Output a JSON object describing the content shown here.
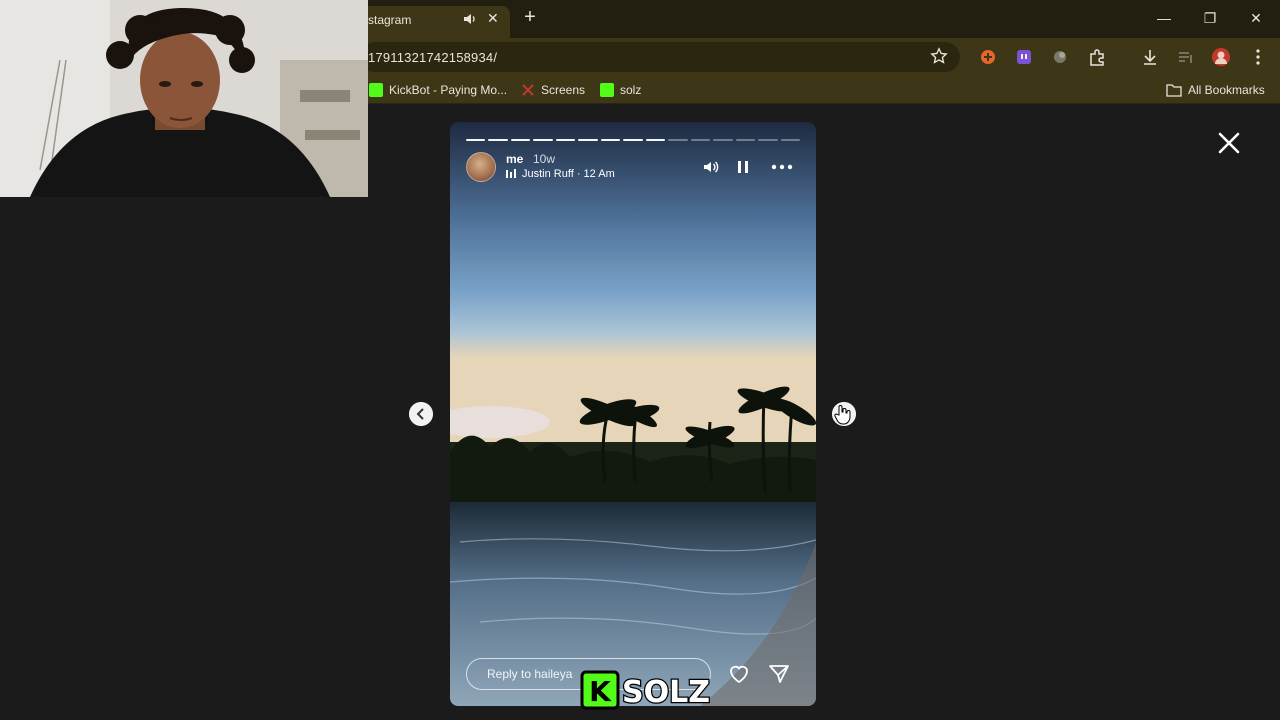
{
  "browser": {
    "tab_title": "stagram",
    "tab_close": "✕",
    "new_tab": "+",
    "url": "17911321742158934/",
    "window_controls": {
      "minimize": "—",
      "restore": "❐",
      "close": "✕"
    },
    "bookmarks": [
      {
        "label": "KickBot - Paying Mo...",
        "icon": "kick-green-icon",
        "color": "#53fc18"
      },
      {
        "label": "Screens",
        "icon": "screens-icon",
        "color": "#c0392b"
      },
      {
        "label": "solz",
        "icon": "kick-k-icon",
        "color": "#53fc18"
      }
    ],
    "all_bookmarks": "All Bookmarks"
  },
  "story": {
    "username": "me",
    "age": "10w",
    "music": "Justin Ruff · 12 Am",
    "progress": {
      "segments": 15,
      "completed": 9
    },
    "reply_placeholder": "Reply to haileya"
  },
  "watermark": {
    "text": "KSOLZ",
    "color": "#53fc18"
  },
  "colors": {
    "chrome_dark": "#231f10",
    "chrome_mid": "#3d3718",
    "page_bg": "#1b1b1b",
    "accent_green": "#53fc18"
  }
}
